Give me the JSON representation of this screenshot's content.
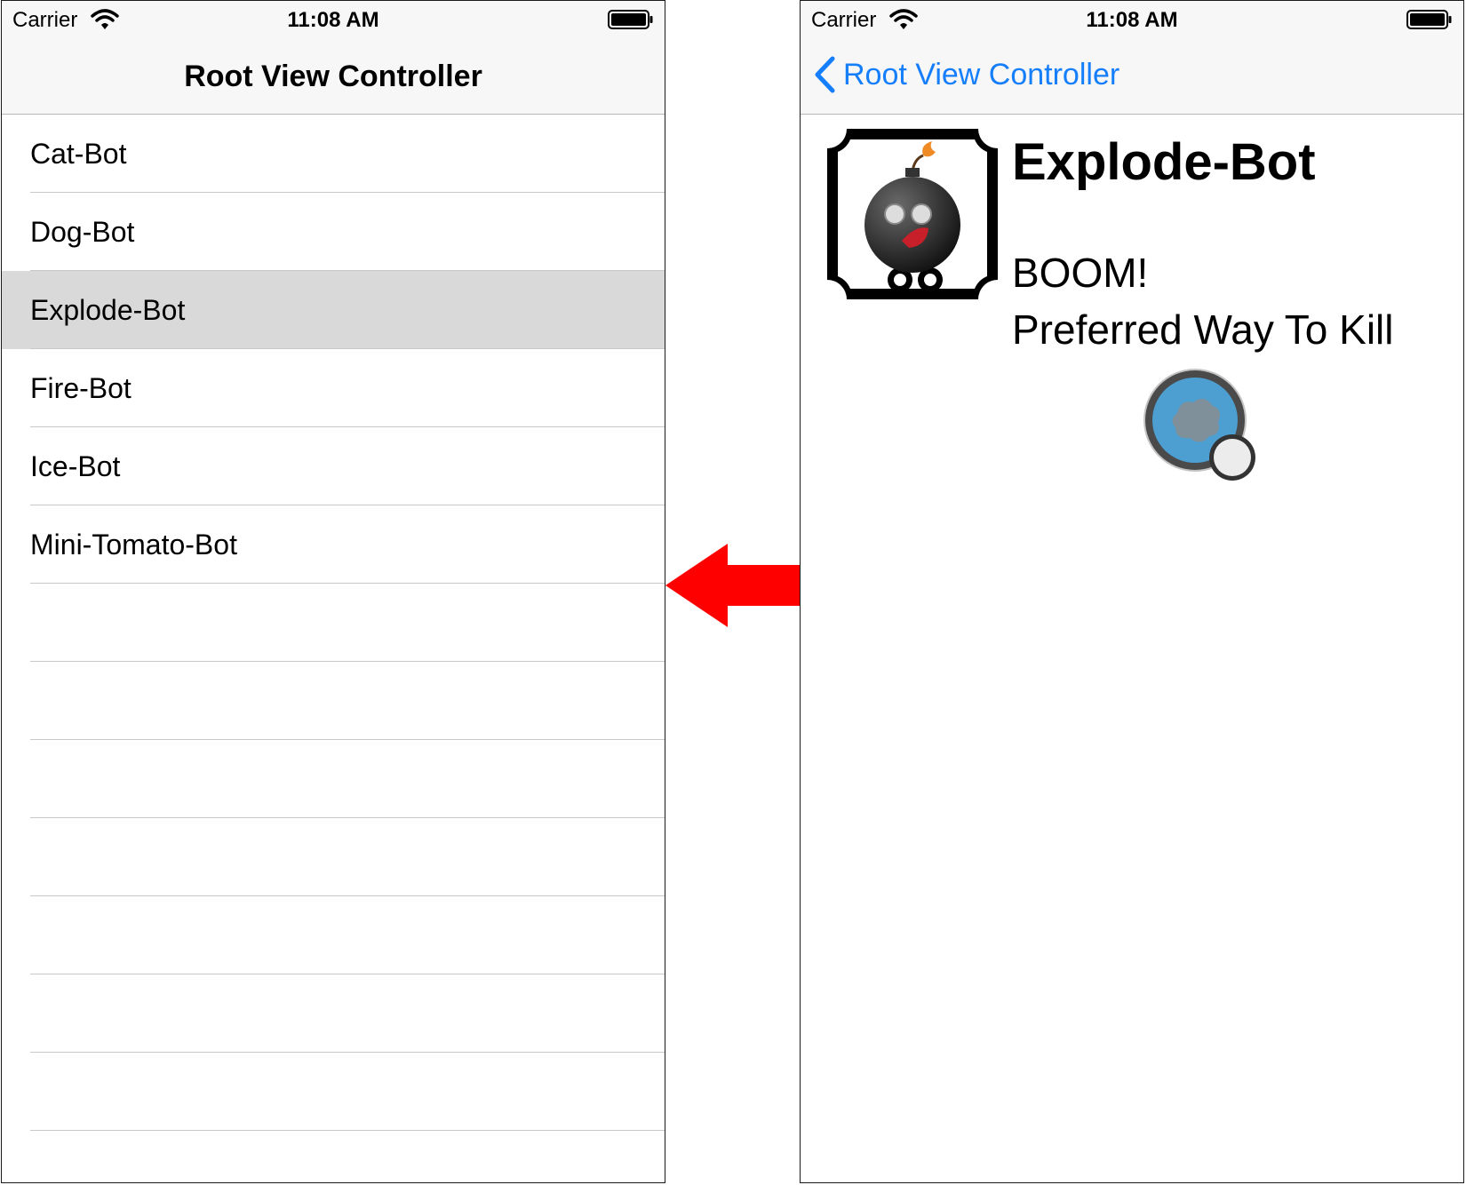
{
  "status_bar": {
    "carrier": "Carrier",
    "time": "11:08 AM"
  },
  "list_screen": {
    "nav_title": "Root View Controller",
    "items": [
      {
        "label": "Cat-Bot"
      },
      {
        "label": "Dog-Bot"
      },
      {
        "label": "Explode-Bot",
        "selected": true
      },
      {
        "label": "Fire-Bot"
      },
      {
        "label": "Ice-Bot"
      },
      {
        "label": "Mini-Tomato-Bot"
      }
    ],
    "empty_row_count": 8
  },
  "detail_screen": {
    "back_label": "Root View Controller",
    "bot_name": "Explode-Bot",
    "sound": "BOOM!",
    "kill_label": "Preferred Way To Kill",
    "bot_icon": "bomb-robot-icon",
    "kill_icon": "explosion-icon"
  },
  "arrow": {
    "direction": "left",
    "icon": "arrow-left-icon",
    "color": "#ff0000"
  },
  "colors": {
    "tint": "#157efb",
    "selected_row": "#d9d9d9",
    "separator": "#c8c7cc",
    "bar_bg": "#f7f7f7"
  }
}
